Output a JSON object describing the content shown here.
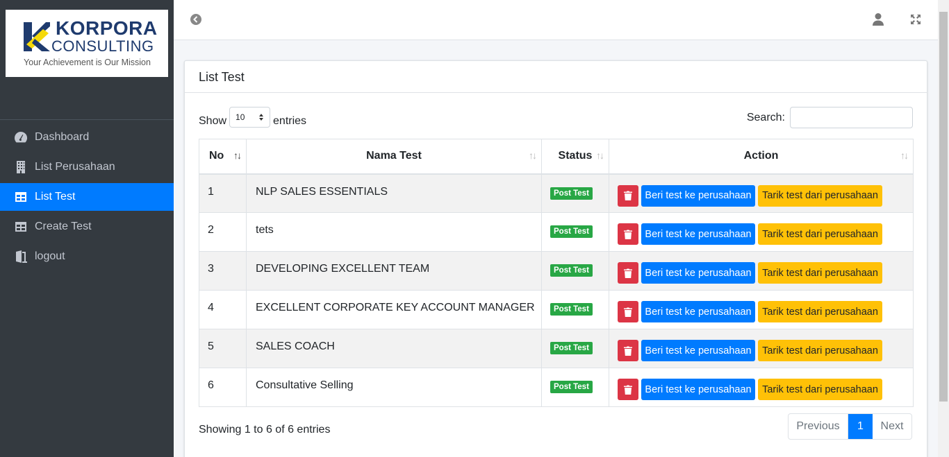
{
  "brand": {
    "name_line1": "KORPORA",
    "name_line2": "CONSULTING",
    "tagline": "Your Achievement is Our Mission"
  },
  "sidebar": {
    "items": [
      {
        "label": "Dashboard",
        "icon": "tachometer-icon",
        "active": false
      },
      {
        "label": "List Perusahaan",
        "icon": "building-icon",
        "active": false
      },
      {
        "label": "List Test",
        "icon": "table-icon",
        "active": true
      },
      {
        "label": "Create Test",
        "icon": "table-icon",
        "active": false
      },
      {
        "label": "logout",
        "icon": "door-exit-icon",
        "active": false
      }
    ]
  },
  "card": {
    "title": "List Test",
    "show_label": "Show",
    "entries_label": "entries",
    "page_length": "10",
    "search_label": "Search:",
    "search_value": ""
  },
  "table": {
    "headers": {
      "no": "No",
      "name": "Nama Test",
      "status": "Status",
      "action": "Action"
    },
    "rows": [
      {
        "no": "1",
        "name": "NLP SALES ESSENTIALS",
        "status": "Post Test"
      },
      {
        "no": "2",
        "name": "tets",
        "status": "Post Test"
      },
      {
        "no": "3",
        "name": "DEVELOPING EXCELLENT TEAM",
        "status": "Post Test"
      },
      {
        "no": "4",
        "name": "EXCELLENT CORPORATE KEY ACCOUNT MANAGER",
        "status": "Post Test"
      },
      {
        "no": "5",
        "name": "SALES COACH",
        "status": "Post Test"
      },
      {
        "no": "6",
        "name": "Consultative Selling",
        "status": "Post Test"
      }
    ],
    "actions": {
      "give_label": "Beri test ke perusahaan",
      "pull_label": "Tarik test dari perusahaan"
    }
  },
  "footer": {
    "info": "Showing 1 to 6 of 6 entries",
    "pager": {
      "prev": "Previous",
      "current": "1",
      "next": "Next"
    }
  },
  "colors": {
    "sidebar": "#343a40",
    "primary": "#007bff",
    "danger": "#dc3545",
    "warning": "#ffc107",
    "success": "#28a745"
  }
}
